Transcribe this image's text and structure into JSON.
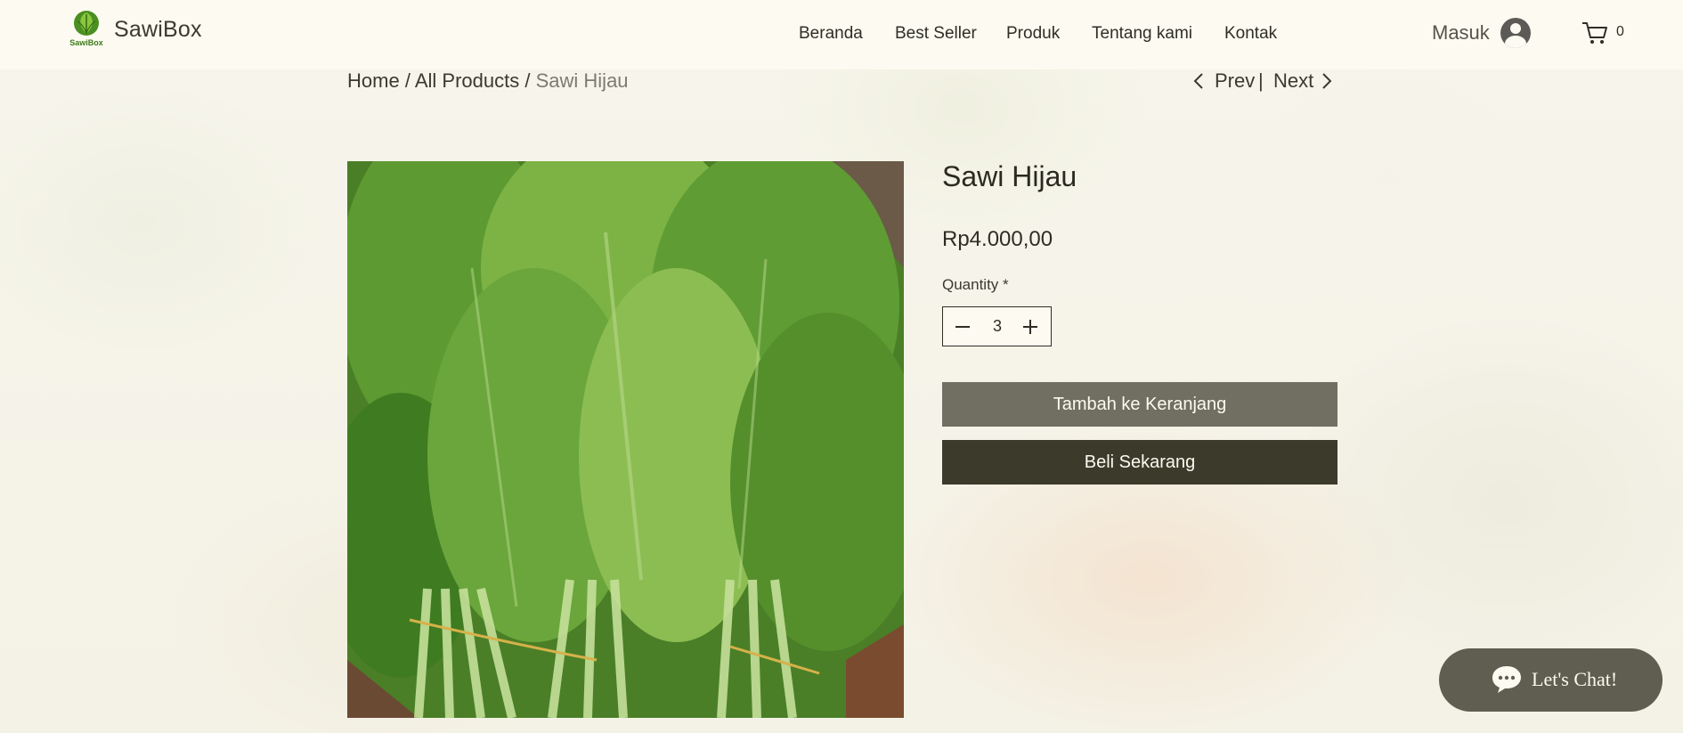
{
  "header": {
    "brand": "SawiBox",
    "logo_text": "SawiBox",
    "nav": [
      "Beranda",
      "Best Seller",
      "Produk",
      "Tentang kami",
      "Kontak"
    ],
    "login_label": "Masuk",
    "cart_count": "0",
    "icons": {
      "avatar": "user-avatar-icon",
      "cart": "cart-icon"
    }
  },
  "breadcrumb": {
    "home": "Home",
    "all_products": "All Products",
    "current": "Sawi Hijau",
    "sep": "/"
  },
  "pager": {
    "prev": "Prev",
    "sep": "|",
    "next": "Next"
  },
  "product": {
    "title": "Sawi Hijau",
    "price": "Rp4.000,00",
    "quantity_label": "Quantity *",
    "quantity": "3",
    "add_to_cart": "Tambah ke Keranjang",
    "buy_now": "Beli Sekarang"
  },
  "chat": {
    "label": "Let's Chat!"
  },
  "colors": {
    "header_bg": "#fcfaf1",
    "primary_button": "#706f61",
    "secondary_button": "#3c3a2a",
    "chat_bg": "#5f5e50"
  }
}
